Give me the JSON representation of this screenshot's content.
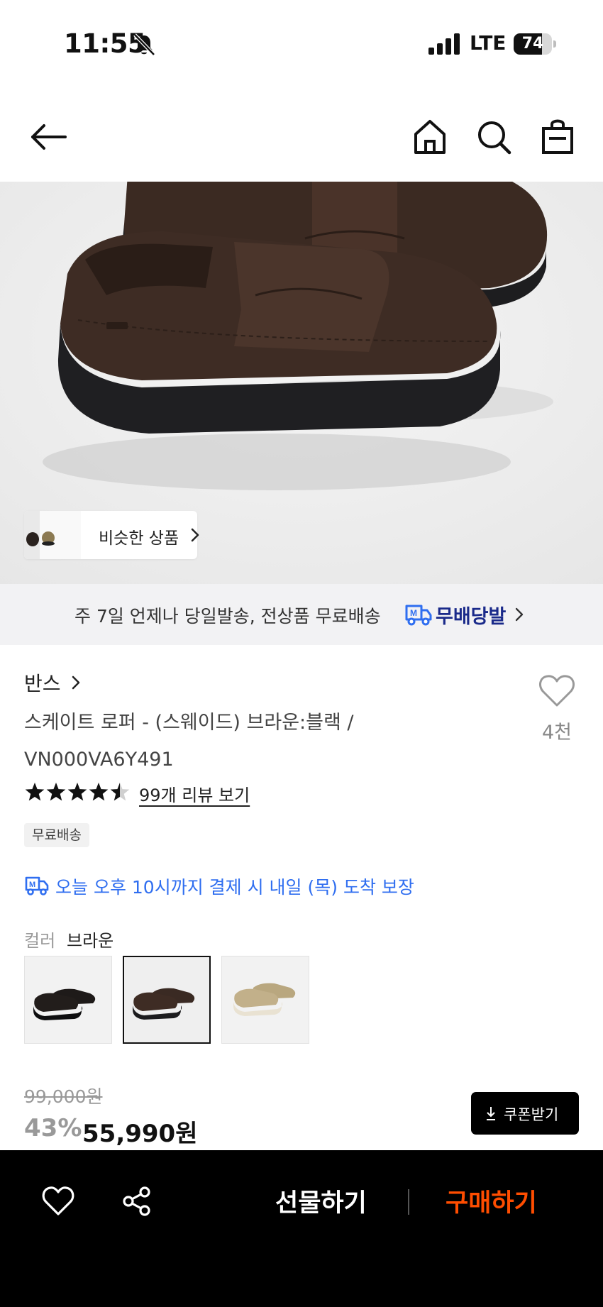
{
  "status_bar": {
    "time": "11:55",
    "network": "LTE",
    "battery_percent": "74",
    "battery_level": 0.74,
    "icons": [
      "bell-muted-icon",
      "signal-icon",
      "battery-icon"
    ]
  },
  "nav": {
    "icons": [
      "back-arrow-icon",
      "home-icon",
      "search-icon",
      "shopping-bag-icon"
    ]
  },
  "hero": {
    "image_alt": "product-image",
    "similar_products_label": "비슷한 상품"
  },
  "delivery_banner": {
    "text": "주 7일 언제나 당일발송, 전상품 무료배송",
    "brand": "무배당발",
    "brand_color": "#1a2a8a"
  },
  "product": {
    "brand": "반스",
    "title": "스케이트 로퍼 - (스웨이드) 브라운:블랙 / VN000VA6Y491",
    "wish_count": "4천",
    "rating": 4.5,
    "review_link": "99개 리뷰 보기",
    "badge": "무료배송",
    "arrival_text": "오늘 오후 10시까지 결제 시 내일 (목) 도착 보장",
    "arrival_color": "#2f6ef0",
    "color_label": "컬러",
    "color_value": "브라운",
    "swatches": [
      {
        "name": "black-black",
        "selected": false
      },
      {
        "name": "brown-black",
        "selected": true
      },
      {
        "name": "beige",
        "selected": false
      }
    ],
    "price_original": "99,000원",
    "discount": "43%",
    "price_sale": "55,990원",
    "coupon_label": "쿠폰받기"
  },
  "bottom_bar": {
    "gift_label": "선물하기",
    "buy_label": "구매하기",
    "buy_color": "#ff4d00"
  }
}
